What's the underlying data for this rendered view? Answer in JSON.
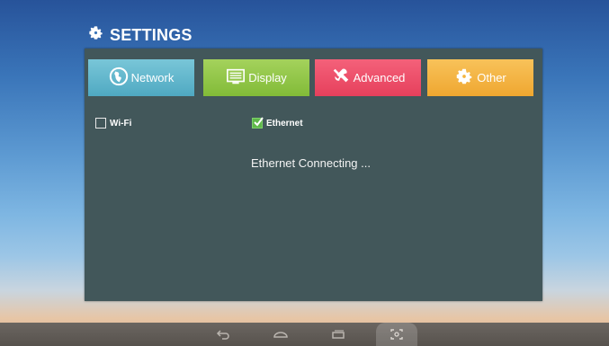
{
  "header": {
    "title": "SETTINGS",
    "icon": "gear-icon"
  },
  "tabs": [
    {
      "label": "Network",
      "icon": "globe-icon",
      "color": "#5fb3cb"
    },
    {
      "label": "Display",
      "icon": "display-icon",
      "color": "#8cc443"
    },
    {
      "label": "Advanced",
      "icon": "tools-icon",
      "color": "#eb4b65"
    },
    {
      "label": "Other",
      "icon": "gear-icon",
      "color": "#f4b53f"
    }
  ],
  "network": {
    "wifi": {
      "label": "Wi-Fi",
      "checked": false
    },
    "ethernet": {
      "label": "Ethernet",
      "checked": true
    },
    "status": "Ethernet Connecting ..."
  },
  "navbar": {
    "buttons": [
      "back-icon",
      "home-icon",
      "recent-apps-icon",
      "screenshot-icon"
    ]
  }
}
